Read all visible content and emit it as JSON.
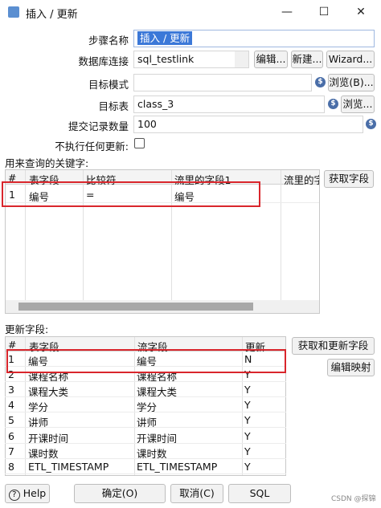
{
  "window": {
    "title": "插入 / 更新",
    "minimize": "—",
    "maximize": "☐",
    "close": "✕"
  },
  "form": {
    "step_name_label": "步骤名称",
    "step_name_value": "插入 / 更新",
    "db_connection_label": "数据库连接",
    "db_connection_value": "sql_testlink",
    "edit_button": "编辑...",
    "new_button": "新建...",
    "wizard_button": "Wizard...",
    "target_schema_label": "目标模式",
    "target_schema_value": "",
    "browse_schema_button": "浏览(B)...",
    "target_table_label": "目标表",
    "target_table_value": "class_3",
    "browse_table_button": "浏览...",
    "commit_size_label": "提交记录数量",
    "commit_size_value": "100",
    "no_update_label": "不执行任何更新:",
    "no_update_checked": false
  },
  "key_section": {
    "label": "用来查询的关键字:",
    "get_fields_button": "获取字段",
    "columns": [
      "#",
      "表字段",
      "比较符",
      "流里的字段1",
      "流里的字"
    ],
    "rows": [
      {
        "num": "1",
        "table_field": "编号",
        "comparator": "=",
        "stream_field": "编号"
      }
    ]
  },
  "update_section": {
    "label": "更新字段:",
    "get_update_button": "获取和更新字段",
    "edit_mapping_button": "编辑映射",
    "columns": [
      "#",
      "表字段",
      "流字段",
      "更新"
    ],
    "rows": [
      {
        "num": "1",
        "table_field": "编号",
        "stream_field": "编号",
        "update": "N"
      },
      {
        "num": "2",
        "table_field": "课程名称",
        "stream_field": "课程名称",
        "update": "Y"
      },
      {
        "num": "3",
        "table_field": "课程大类",
        "stream_field": "课程大类",
        "update": "Y"
      },
      {
        "num": "4",
        "table_field": "学分",
        "stream_field": "学分",
        "update": "Y"
      },
      {
        "num": "5",
        "table_field": "讲师",
        "stream_field": "讲师",
        "update": "Y"
      },
      {
        "num": "6",
        "table_field": "开课时间",
        "stream_field": "开课时间",
        "update": "Y"
      },
      {
        "num": "7",
        "table_field": "课时数",
        "stream_field": "课时数",
        "update": "Y"
      },
      {
        "num": "8",
        "table_field": "ETL_TIMESTAMP",
        "stream_field": "ETL_TIMESTAMP",
        "update": "Y"
      }
    ]
  },
  "footer": {
    "help_button": "Help",
    "ok_button": "确定(O)",
    "cancel_button": "取消(C)",
    "sql_button": "SQL",
    "watermark": "CSDN @探锦"
  },
  "colors": {
    "highlight_red": "#d9262c",
    "selection_blue": "#3b78d8"
  }
}
